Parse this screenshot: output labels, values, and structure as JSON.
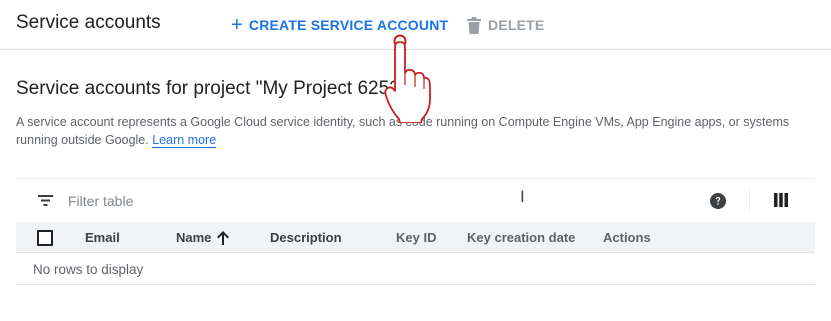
{
  "header": {
    "title": "Service accounts",
    "create_label": "CREATE SERVICE ACCOUNT",
    "create_icon": "plus-icon",
    "delete_label": "DELETE",
    "delete_icon": "trash-icon"
  },
  "section": {
    "title": "Service accounts for project \"My Project 62525\"",
    "description": "A service account represents a Google Cloud service identity, such as code running on Compute Engine VMs, App Engine apps, or systems running outside Google.",
    "learn_more": "Learn more"
  },
  "table": {
    "filter_placeholder": "Filter table",
    "columns": [
      "Email",
      "Name",
      "Description",
      "Key ID",
      "Key creation date",
      "Actions"
    ],
    "sort_column": "Name",
    "sort_direction": "ascending",
    "empty_message": "No rows to display"
  },
  "colors": {
    "accent": "#1a73e8",
    "disabled": "#9aa0a6",
    "header_bg": "#f1f3f4"
  }
}
